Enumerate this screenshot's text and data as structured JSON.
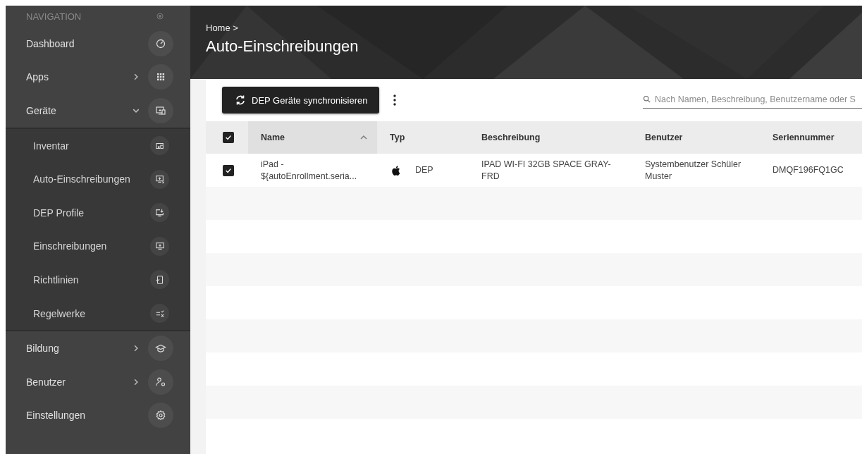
{
  "sidebar": {
    "heading": "NAVIGATION",
    "items": [
      {
        "label": "Dashboard",
        "kind": "link"
      },
      {
        "label": "Apps",
        "expanded": false,
        "kind": "group"
      },
      {
        "label": "Geräte",
        "expanded": true,
        "kind": "group",
        "children": [
          {
            "label": "Inventar"
          },
          {
            "label": "Auto-Einschreibungen"
          },
          {
            "label": "DEP Profile"
          },
          {
            "label": "Einschreibungen"
          },
          {
            "label": "Richtlinien"
          },
          {
            "label": "Regelwerke"
          }
        ]
      },
      {
        "label": "Bildung",
        "expanded": false,
        "kind": "group"
      },
      {
        "label": "Benutzer",
        "expanded": false,
        "kind": "group"
      },
      {
        "label": "Einstellungen",
        "kind": "link"
      }
    ]
  },
  "header": {
    "breadcrumb": "Home >",
    "title": "Auto-Einschreibungen"
  },
  "toolbar": {
    "sync_button": "DEP Geräte synchronisieren",
    "search": {
      "placeholder": "Nach Namen, Beschreibung, Benutzername oder S"
    }
  },
  "table": {
    "select_all_checked": true,
    "columns": [
      {
        "label": "Name",
        "sorted": true
      },
      {
        "label": "Typ",
        "sorted": false
      },
      {
        "label": "Beschreibung",
        "sorted": false
      },
      {
        "label": "Benutzer",
        "sorted": false
      },
      {
        "label": "Seriennummer",
        "sorted": false
      }
    ],
    "rows": [
      {
        "checked": true,
        "name": "iPad - ${autoEnrollment.seria...",
        "type": "DEP",
        "description": "IPAD WI-FI 32GB SPACE GRAY-FRD",
        "user": "Systembenutzer Schüler Muster",
        "serial": "DMQF196FQ1GC"
      }
    ]
  }
}
